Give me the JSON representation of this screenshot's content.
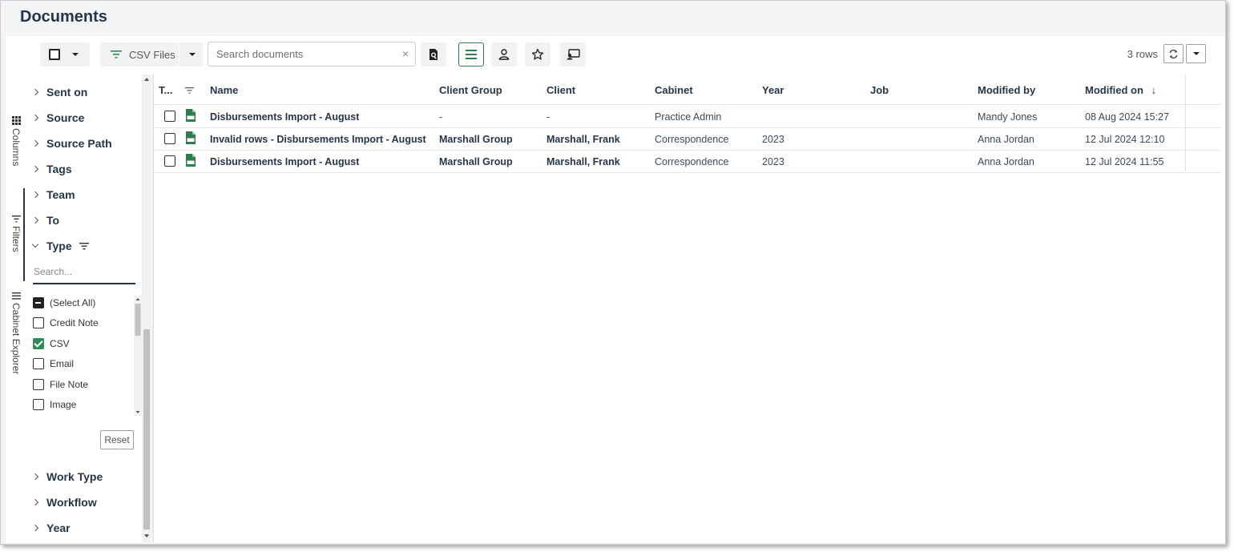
{
  "header": {
    "title": "Documents"
  },
  "toolbar": {
    "filter_label": "CSV Files",
    "search_placeholder": "Search documents",
    "clear_glyph": "×",
    "row_count": "3 rows",
    "icons": [
      "select-all-checkbox-icon",
      "filter-icon",
      "document-search-icon",
      "list-view-icon",
      "person-icon",
      "star-icon",
      "presentation-icon",
      "refresh-icon"
    ]
  },
  "rail": {
    "tabs": [
      {
        "label": "Columns",
        "icon": "grid-icon"
      },
      {
        "label": "Filters",
        "icon": "filter-icon"
      },
      {
        "label": "Cabinet Explorer",
        "icon": "menu-icon"
      }
    ]
  },
  "filters": {
    "groups_top": [
      "Sent on",
      "Source",
      "Source Path",
      "Tags",
      "Team",
      "To"
    ],
    "expanded_group": "Type",
    "search_placeholder": "Search...",
    "options": [
      {
        "label": "(Select All)",
        "state": "mixed"
      },
      {
        "label": "Credit Note",
        "state": "unchecked"
      },
      {
        "label": "CSV",
        "state": "checked"
      },
      {
        "label": "Email",
        "state": "unchecked"
      },
      {
        "label": "File Note",
        "state": "unchecked"
      },
      {
        "label": "Image",
        "state": "unchecked"
      }
    ],
    "reset_label": "Reset",
    "groups_bottom": [
      "Work Type",
      "Workflow",
      "Year"
    ]
  },
  "grid": {
    "columns": [
      {
        "key": "type",
        "label": "T..."
      },
      {
        "key": "name",
        "label": "Name"
      },
      {
        "key": "client_group",
        "label": "Client Group"
      },
      {
        "key": "client",
        "label": "Client"
      },
      {
        "key": "cabinet",
        "label": "Cabinet"
      },
      {
        "key": "year",
        "label": "Year"
      },
      {
        "key": "job",
        "label": "Job"
      },
      {
        "key": "modified_by",
        "label": "Modified by"
      },
      {
        "key": "modified_on",
        "label": "Modified on",
        "sort_glyph": "↓"
      }
    ],
    "rows": [
      {
        "name": "Disbursements Import - August",
        "client_group": "-",
        "client": "-",
        "cabinet": "Practice Admin",
        "year": "",
        "job": "",
        "modified_by": "Mandy Jones",
        "modified_on": "08 Aug 2024 15:27"
      },
      {
        "name": "Invalid rows - Disbursements Import - August",
        "client_group": "Marshall Group",
        "client": "Marshall, Frank",
        "cabinet": "Correspondence",
        "year": "2023",
        "job": "",
        "modified_by": "Anna Jordan",
        "modified_on": "12 Jul 2024 12:10"
      },
      {
        "name": "Disbursements Import - August",
        "client_group": "Marshall Group",
        "client": "Marshall, Frank",
        "cabinet": "Correspondence",
        "year": "2023",
        "job": "",
        "modified_by": "Anna Jordan",
        "modified_on": "12 Jul 2024 11:55"
      }
    ]
  },
  "colors": {
    "accent_green": "#2e8b57",
    "heading": "#25364b"
  }
}
